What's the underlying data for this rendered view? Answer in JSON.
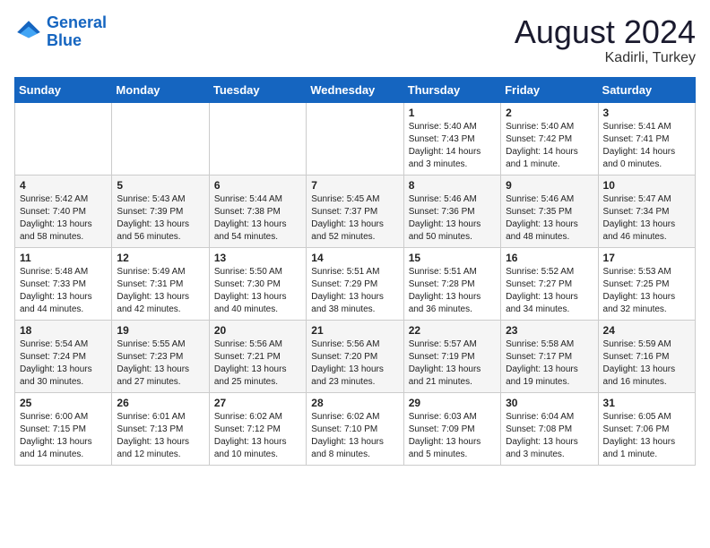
{
  "header": {
    "logo_line1": "General",
    "logo_line2": "Blue",
    "month_year": "August 2024",
    "location": "Kadirli, Turkey"
  },
  "weekdays": [
    "Sunday",
    "Monday",
    "Tuesday",
    "Wednesday",
    "Thursday",
    "Friday",
    "Saturday"
  ],
  "weeks": [
    [
      {
        "day": "",
        "info": ""
      },
      {
        "day": "",
        "info": ""
      },
      {
        "day": "",
        "info": ""
      },
      {
        "day": "",
        "info": ""
      },
      {
        "day": "1",
        "info": "Sunrise: 5:40 AM\nSunset: 7:43 PM\nDaylight: 14 hours\nand 3 minutes."
      },
      {
        "day": "2",
        "info": "Sunrise: 5:40 AM\nSunset: 7:42 PM\nDaylight: 14 hours\nand 1 minute."
      },
      {
        "day": "3",
        "info": "Sunrise: 5:41 AM\nSunset: 7:41 PM\nDaylight: 14 hours\nand 0 minutes."
      }
    ],
    [
      {
        "day": "4",
        "info": "Sunrise: 5:42 AM\nSunset: 7:40 PM\nDaylight: 13 hours\nand 58 minutes."
      },
      {
        "day": "5",
        "info": "Sunrise: 5:43 AM\nSunset: 7:39 PM\nDaylight: 13 hours\nand 56 minutes."
      },
      {
        "day": "6",
        "info": "Sunrise: 5:44 AM\nSunset: 7:38 PM\nDaylight: 13 hours\nand 54 minutes."
      },
      {
        "day": "7",
        "info": "Sunrise: 5:45 AM\nSunset: 7:37 PM\nDaylight: 13 hours\nand 52 minutes."
      },
      {
        "day": "8",
        "info": "Sunrise: 5:46 AM\nSunset: 7:36 PM\nDaylight: 13 hours\nand 50 minutes."
      },
      {
        "day": "9",
        "info": "Sunrise: 5:46 AM\nSunset: 7:35 PM\nDaylight: 13 hours\nand 48 minutes."
      },
      {
        "day": "10",
        "info": "Sunrise: 5:47 AM\nSunset: 7:34 PM\nDaylight: 13 hours\nand 46 minutes."
      }
    ],
    [
      {
        "day": "11",
        "info": "Sunrise: 5:48 AM\nSunset: 7:33 PM\nDaylight: 13 hours\nand 44 minutes."
      },
      {
        "day": "12",
        "info": "Sunrise: 5:49 AM\nSunset: 7:31 PM\nDaylight: 13 hours\nand 42 minutes."
      },
      {
        "day": "13",
        "info": "Sunrise: 5:50 AM\nSunset: 7:30 PM\nDaylight: 13 hours\nand 40 minutes."
      },
      {
        "day": "14",
        "info": "Sunrise: 5:51 AM\nSunset: 7:29 PM\nDaylight: 13 hours\nand 38 minutes."
      },
      {
        "day": "15",
        "info": "Sunrise: 5:51 AM\nSunset: 7:28 PM\nDaylight: 13 hours\nand 36 minutes."
      },
      {
        "day": "16",
        "info": "Sunrise: 5:52 AM\nSunset: 7:27 PM\nDaylight: 13 hours\nand 34 minutes."
      },
      {
        "day": "17",
        "info": "Sunrise: 5:53 AM\nSunset: 7:25 PM\nDaylight: 13 hours\nand 32 minutes."
      }
    ],
    [
      {
        "day": "18",
        "info": "Sunrise: 5:54 AM\nSunset: 7:24 PM\nDaylight: 13 hours\nand 30 minutes."
      },
      {
        "day": "19",
        "info": "Sunrise: 5:55 AM\nSunset: 7:23 PM\nDaylight: 13 hours\nand 27 minutes."
      },
      {
        "day": "20",
        "info": "Sunrise: 5:56 AM\nSunset: 7:21 PM\nDaylight: 13 hours\nand 25 minutes."
      },
      {
        "day": "21",
        "info": "Sunrise: 5:56 AM\nSunset: 7:20 PM\nDaylight: 13 hours\nand 23 minutes."
      },
      {
        "day": "22",
        "info": "Sunrise: 5:57 AM\nSunset: 7:19 PM\nDaylight: 13 hours\nand 21 minutes."
      },
      {
        "day": "23",
        "info": "Sunrise: 5:58 AM\nSunset: 7:17 PM\nDaylight: 13 hours\nand 19 minutes."
      },
      {
        "day": "24",
        "info": "Sunrise: 5:59 AM\nSunset: 7:16 PM\nDaylight: 13 hours\nand 16 minutes."
      }
    ],
    [
      {
        "day": "25",
        "info": "Sunrise: 6:00 AM\nSunset: 7:15 PM\nDaylight: 13 hours\nand 14 minutes."
      },
      {
        "day": "26",
        "info": "Sunrise: 6:01 AM\nSunset: 7:13 PM\nDaylight: 13 hours\nand 12 minutes."
      },
      {
        "day": "27",
        "info": "Sunrise: 6:02 AM\nSunset: 7:12 PM\nDaylight: 13 hours\nand 10 minutes."
      },
      {
        "day": "28",
        "info": "Sunrise: 6:02 AM\nSunset: 7:10 PM\nDaylight: 13 hours\nand 8 minutes."
      },
      {
        "day": "29",
        "info": "Sunrise: 6:03 AM\nSunset: 7:09 PM\nDaylight: 13 hours\nand 5 minutes."
      },
      {
        "day": "30",
        "info": "Sunrise: 6:04 AM\nSunset: 7:08 PM\nDaylight: 13 hours\nand 3 minutes."
      },
      {
        "day": "31",
        "info": "Sunrise: 6:05 AM\nSunset: 7:06 PM\nDaylight: 13 hours\nand 1 minute."
      }
    ]
  ]
}
